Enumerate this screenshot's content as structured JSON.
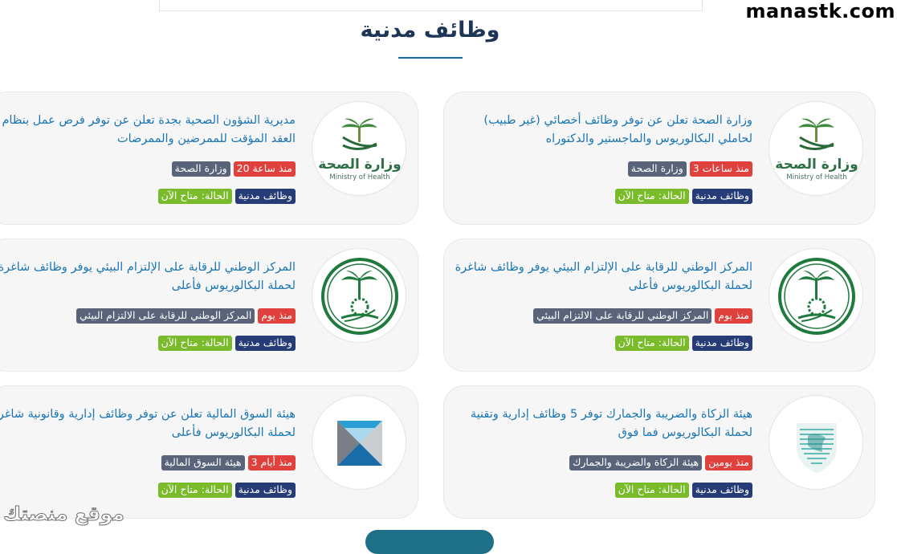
{
  "site": {
    "watermark": "manastk.com",
    "bottom_watermark": "موقع منصتك"
  },
  "section": {
    "title": "وظائف مدنية"
  },
  "cards": [
    {
      "title": "وزارة الصحة تعلن عن توفر وظائف أخصائي (غير طبيب) لحاملي البكالوريوس والماجستير والدكتوراه",
      "time": "منذ ساعات 3",
      "org": "وزارة الصحة",
      "category": "وظائف مدنية",
      "status": "الحالة: متاح الآن",
      "logo": "ministry-of-health-logo",
      "logo_text_ar": "وزارة الصحة",
      "logo_text_en": "Ministry of Health"
    },
    {
      "title": "مديرية الشؤون الصحية بجدة تعلن عن توفر فرص عمل بنظام العقد المؤقت للممرضين والممرضات",
      "time": "منذ ساعة 20",
      "org": "وزارة الصحة",
      "category": "وظائف مدنية",
      "status": "الحالة: متاح الآن",
      "logo": "ministry-of-health-logo",
      "logo_text_ar": "وزارة الصحة",
      "logo_text_en": "Ministry of Health"
    },
    {
      "title": "المركز الوطني للرقابة على الإلتزام البيئي يوفر وظائف شاغرة لحملة البكالوريوس فأعلى",
      "time": "منذ يوم",
      "org": "المركز الوطني للرقابة على الالتزام البيئي",
      "category": "وظائف مدنية",
      "status": "الحالة: متاح الآن",
      "logo": "environmental-center-logo"
    },
    {
      "title": "المركز الوطني للرقابة على الإلتزام البيئي يوفر وظائف شاغرة لحملة البكالوريوس فأعلى",
      "time": "منذ يوم",
      "org": "المركز الوطني للرقابة على الالتزام البيئي",
      "category": "وظائف مدنية",
      "status": "الحالة: متاح الآن",
      "logo": "environmental-center-logo"
    },
    {
      "title": "هيئة الزكاة والضريبة والجمارك توفر 5 وظائف إدارية وتقنية لحملة البكالوريوس فما فوق",
      "time": "منذ يومين",
      "org": "هيئة الزكاة والضريبة والجمارك",
      "category": "وظائف مدنية",
      "status": "الحالة: متاح الآن",
      "logo": "zatca-logo"
    },
    {
      "title": "هيئة السوق المالية تعلن عن توفر وظائف إدارية وقانونية شاغرة لحملة البكالوريوس فأعلى",
      "time": "منذ أيام 3",
      "org": "هيئة السوق المالية",
      "category": "وظائف مدنية",
      "status": "الحالة: متاح الآن",
      "logo": "cma-logo"
    }
  ],
  "colors": {
    "title": "#1b76b3",
    "time_badge": "#e0413c",
    "org_badge": "#59647a",
    "category_badge": "#253c77",
    "status_badge": "#79bb2a"
  }
}
